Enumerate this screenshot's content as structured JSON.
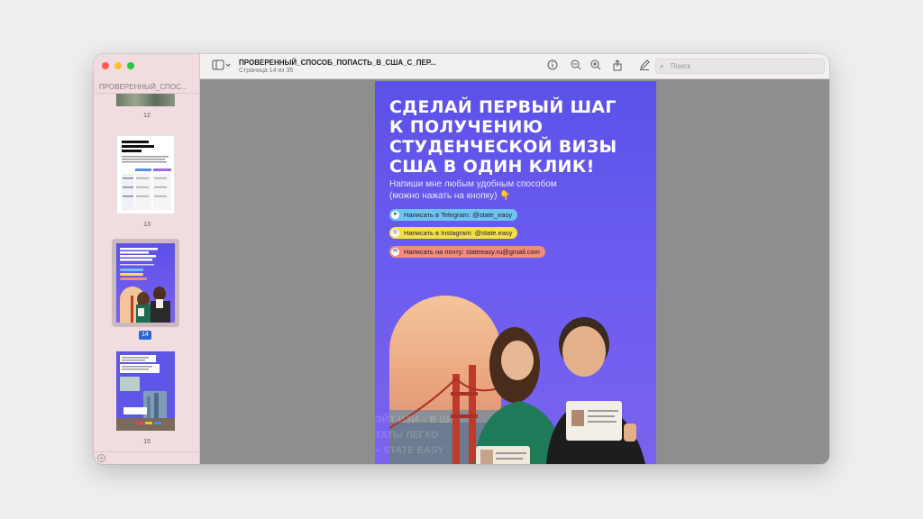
{
  "window": {
    "sidebar_title": "ПРОВЕРЕННЫЙ_СПОС...",
    "doc_title": "ПРОВЕРЕННЫЙ_СПОСОБ_ПОПАСТЬ_В_США_С_ПЕР...",
    "doc_subtitle": "Страница 14 из 35",
    "search_placeholder": "Поиск"
  },
  "thumbnails": [
    {
      "page": "12",
      "selected": false
    },
    {
      "page": "13",
      "selected": false,
      "heading": "ПОЧЕМУ СТУДЕНЧЕСКАЯ ВИЗА?"
    },
    {
      "page": "14",
      "selected": true,
      "heading": "СДЕЛАЙ ПЕРВЫЙ ШАГ К ПОЛУЧЕНИЮ СТУДЕНЧЕСКОЙ ВИЗЫ США В ОДИН КЛИК!"
    },
    {
      "page": "15",
      "selected": false
    }
  ],
  "page": {
    "headline": [
      "СДЕЛАЙ ПЕРВЫЙ ШАГ",
      "К ПОЛУЧЕНИЮ",
      "СТУДЕНЧЕСКОЙ ВИЗЫ",
      "США В ОДИН КЛИК!"
    ],
    "subtext": [
      "Напиши мне любым удобным способом",
      "(можно нажать на кнопку) 👇"
    ],
    "pills": [
      {
        "label": "Написать в Telegram: @state_easy",
        "color": "#6fc3f2",
        "icon": "telegram-icon"
      },
      {
        "label": "Написать в Instagram: @state.easy",
        "color": "#f5e04a",
        "icon": "instagram-icon"
      },
      {
        "label": "Написать на почту: stateeasy.ru@gmail.com",
        "color": "#f28c7d",
        "icon": "mail-icon"
      }
    ],
    "marquee": [
      "ЭЙТ ИЗИ – В Ш",
      "ТАТЫ ЛЕГКО",
      "– STATE EASY"
    ]
  },
  "colors": {
    "page_bg": "#5b50e8",
    "sidebar_bg": "#f1dcdf",
    "selection_accent": "#2a66d9"
  }
}
